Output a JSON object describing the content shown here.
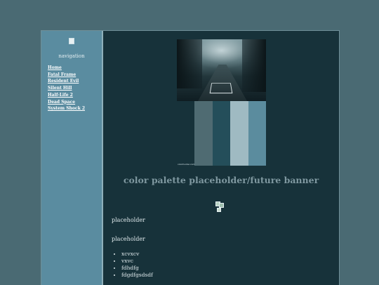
{
  "sidebar": {
    "heading": "navigation",
    "items": [
      {
        "label": "Home"
      },
      {
        "label": "Fatal Frame"
      },
      {
        "label": "Resident Evil"
      },
      {
        "label": "Silent Hill"
      },
      {
        "label": "Half-Life 2"
      },
      {
        "label": "Dead Space"
      },
      {
        "label": "System Shock 2"
      }
    ]
  },
  "palette": {
    "colors": [
      "#4f6b72",
      "#244e5a",
      "#9fbac2",
      "#5b8c9e"
    ],
    "credit": "colorhunter.com"
  },
  "main": {
    "banner": "color palette placeholder/future banner",
    "paragraphs": [
      "placeholder",
      "placeholder"
    ],
    "bullets": [
      "xcvxcv",
      "vxvc",
      "fdhdfg",
      "fdgdfgsdsdf"
    ]
  },
  "colors": {
    "page_bg": "#4a6a73",
    "sidebar_bg": "#5a8ca0",
    "main_bg": "#17323a",
    "banner_text": "#7f98a0"
  }
}
